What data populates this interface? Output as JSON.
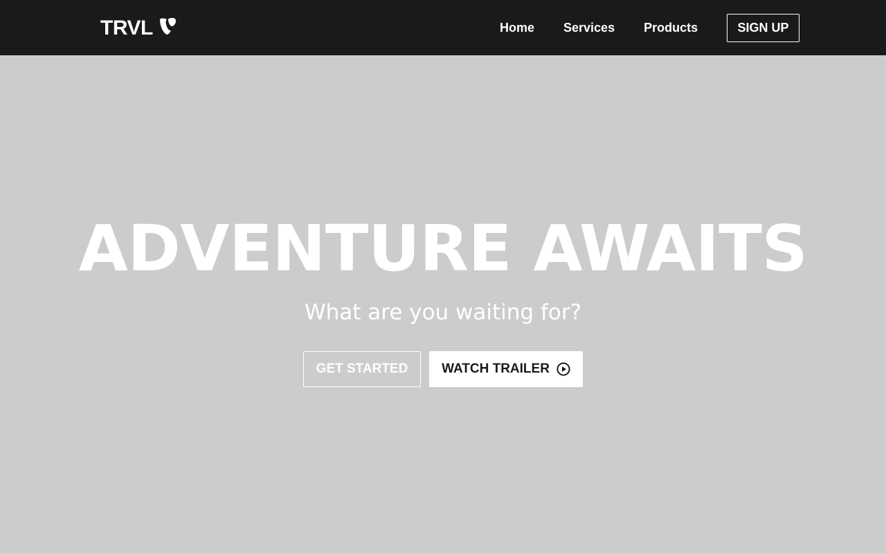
{
  "brand": {
    "name": "TRVL",
    "logo_icon": "typo3-logo-icon"
  },
  "nav": {
    "items": [
      {
        "label": "Home"
      },
      {
        "label": "Services"
      },
      {
        "label": "Products"
      }
    ],
    "signup_label": "SIGN UP"
  },
  "hero": {
    "title": "ADVENTURE AWAITS",
    "subtitle": "What are you waiting for?",
    "primary_button_label": "GET STARTED",
    "secondary_button_label": "WATCH TRAILER",
    "secondary_button_icon": "play-circle-icon"
  },
  "colors": {
    "navbar_bg": "#1b1a1a",
    "hero_bg": "#cccccc",
    "text_light": "#ffffff",
    "text_dark": "#1b1a1a"
  }
}
